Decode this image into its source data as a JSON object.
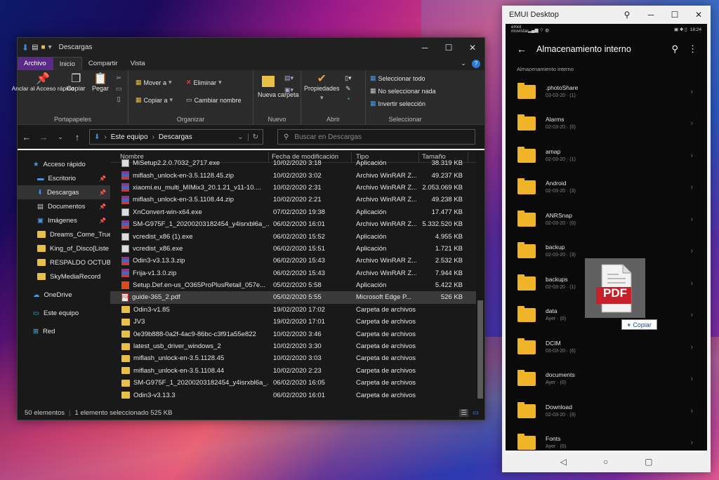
{
  "explorer": {
    "title": "Descargas",
    "tabs": [
      "Archivo",
      "Inicio",
      "Compartir",
      "Vista"
    ],
    "ribbon": {
      "anclar": "Anclar al Acceso rápido",
      "copiar": "Copiar",
      "pegar": "Pegar",
      "portapapeles": "Portapapeles",
      "mover_a": "Mover a",
      "copiar_a": "Copiar a",
      "eliminar": "Eliminar",
      "cambiar_nombre": "Cambiar nombre",
      "organizar": "Organizar",
      "nueva_carpeta": "Nueva carpeta",
      "nuevo": "Nuevo",
      "propiedades": "Propiedades",
      "abrir": "Abrir",
      "seleccionar_todo": "Seleccionar todo",
      "no_seleccionar": "No seleccionar nada",
      "invertir": "Invertir selección",
      "seleccionar": "Seleccionar"
    },
    "path": [
      "Este equipo",
      "Descargas"
    ],
    "search_placeholder": "Buscar en Descargas",
    "nav": {
      "acceso_rapido": "Acceso rápido",
      "escritorio": "Escritorio",
      "descargas": "Descargas",
      "documentos": "Documentos",
      "imagenes": "Imágenes",
      "dreams": "Dreams_Come_True",
      "king": "King_of_Disco[Liste",
      "respaldo": "RESPALDO OCTUBR",
      "skymedia": "SkyMediaRecord",
      "onedrive": "OneDrive",
      "este_equipo": "Este equipo",
      "red": "Red"
    },
    "columns": [
      "Nombre",
      "Fecha de modificación",
      "Tipo",
      "Tamaño"
    ],
    "rows": [
      {
        "name": "MiSetup2.2.0.7032_2717.exe",
        "date": "10/02/2020 3:18",
        "type": "Aplicación",
        "size": "38.319 KB"
      },
      {
        "name": "miflash_unlock-en-3.5.1128.45.zip",
        "date": "10/02/2020 3:02",
        "type": "Archivo WinRAR Z...",
        "size": "49.237 KB"
      },
      {
        "name": "xiaomi.eu_multi_MIMix3_20.1.21_v11-10....",
        "date": "10/02/2020 2:31",
        "type": "Archivo WinRAR Z...",
        "size": "2.053.069 KB"
      },
      {
        "name": "miflash_unlock-en-3.5.1108.44.zip",
        "date": "10/02/2020 2:21",
        "type": "Archivo WinRAR Z...",
        "size": "49.238 KB"
      },
      {
        "name": "XnConvert-win-x64.exe",
        "date": "07/02/2020 19:38",
        "type": "Aplicación",
        "size": "17.477 KB"
      },
      {
        "name": "SM-G975F_1_20200203182454_y4isrxbl6a_...",
        "date": "06/02/2020 16:01",
        "type": "Archivo WinRAR Z...",
        "size": "5.332.520 KB"
      },
      {
        "name": "vcredist_x86 (1).exe",
        "date": "06/02/2020 15:52",
        "type": "Aplicación",
        "size": "4.955 KB"
      },
      {
        "name": "vcredist_x86.exe",
        "date": "06/02/2020 15:51",
        "type": "Aplicación",
        "size": "1.721 KB"
      },
      {
        "name": "Odin3-v3.13.3.zip",
        "date": "06/02/2020 15:43",
        "type": "Archivo WinRAR Z...",
        "size": "2.532 KB"
      },
      {
        "name": "Frija-v1.3.0.zip",
        "date": "06/02/2020 15:43",
        "type": "Archivo WinRAR Z...",
        "size": "7.944 KB"
      },
      {
        "name": "Setup.Def.en-us_O365ProPlusRetail_057e...",
        "date": "05/02/2020 5:58",
        "type": "Aplicación",
        "size": "5.422 KB"
      },
      {
        "name": "guide-365_2.pdf",
        "date": "05/02/2020 5:55",
        "type": "Microsoft Edge P...",
        "size": "526 KB"
      },
      {
        "name": "Odin3-v1.85",
        "date": "19/02/2020 17:02",
        "type": "Carpeta de archivos",
        "size": ""
      },
      {
        "name": "JV3",
        "date": "19/02/2020 17:01",
        "type": "Carpeta de archivos",
        "size": ""
      },
      {
        "name": "0e39b888-0a2f-4ac9-86bc-c3f91a55e822",
        "date": "10/02/2020 3:46",
        "type": "Carpeta de archivos",
        "size": ""
      },
      {
        "name": "latest_usb_driver_windows_2",
        "date": "10/02/2020 3:30",
        "type": "Carpeta de archivos",
        "size": ""
      },
      {
        "name": "miflash_unlock-en-3.5.1128.45",
        "date": "10/02/2020 3:03",
        "type": "Carpeta de archivos",
        "size": ""
      },
      {
        "name": "miflash_unlock-en-3.5.1108.44",
        "date": "10/02/2020 2:23",
        "type": "Carpeta de archivos",
        "size": ""
      },
      {
        "name": "SM-G975F_1_20200203182454_y4isrxbl6a_...",
        "date": "06/02/2020 16:05",
        "type": "Carpeta de archivos",
        "size": ""
      },
      {
        "name": "Odin3-v3.13.3",
        "date": "06/02/2020 16:01",
        "type": "Carpeta de archivos",
        "size": ""
      }
    ],
    "status": {
      "count": "50 elementos",
      "selected": "1 elemento seleccionado  525 KB"
    }
  },
  "phone": {
    "window_title": "EMUI Desktop",
    "status_left": "emol movistar",
    "time": "18:24",
    "header_title": "Almacenamiento interno",
    "breadcrumb": "Almacenamiento interno",
    "folders": [
      {
        "name": ".photoShare",
        "meta": "03-03-20 · (1)"
      },
      {
        "name": "Alarms",
        "meta": "02-03-20 · (0)"
      },
      {
        "name": "amap",
        "meta": "02-03-20 · (1)"
      },
      {
        "name": "Android",
        "meta": "02-03-20 · (3)"
      },
      {
        "name": "ANRSnap",
        "meta": "02-03-20 · (0)"
      },
      {
        "name": "backup",
        "meta": "02-03-20 · (3)"
      },
      {
        "name": "backups",
        "meta": "02-03-20 · (1)"
      },
      {
        "name": "data",
        "meta": "Ayer · (0)"
      },
      {
        "name": "DCIM",
        "meta": "03-03-20 · (6)"
      },
      {
        "name": "documents",
        "meta": "Ayer · (0)"
      },
      {
        "name": "Download",
        "meta": "02-03-20 · (3)"
      },
      {
        "name": "Fonts",
        "meta": "Ayer · (0)"
      }
    ]
  },
  "drag": {
    "badge": "PDF",
    "tip": "Copiar"
  }
}
